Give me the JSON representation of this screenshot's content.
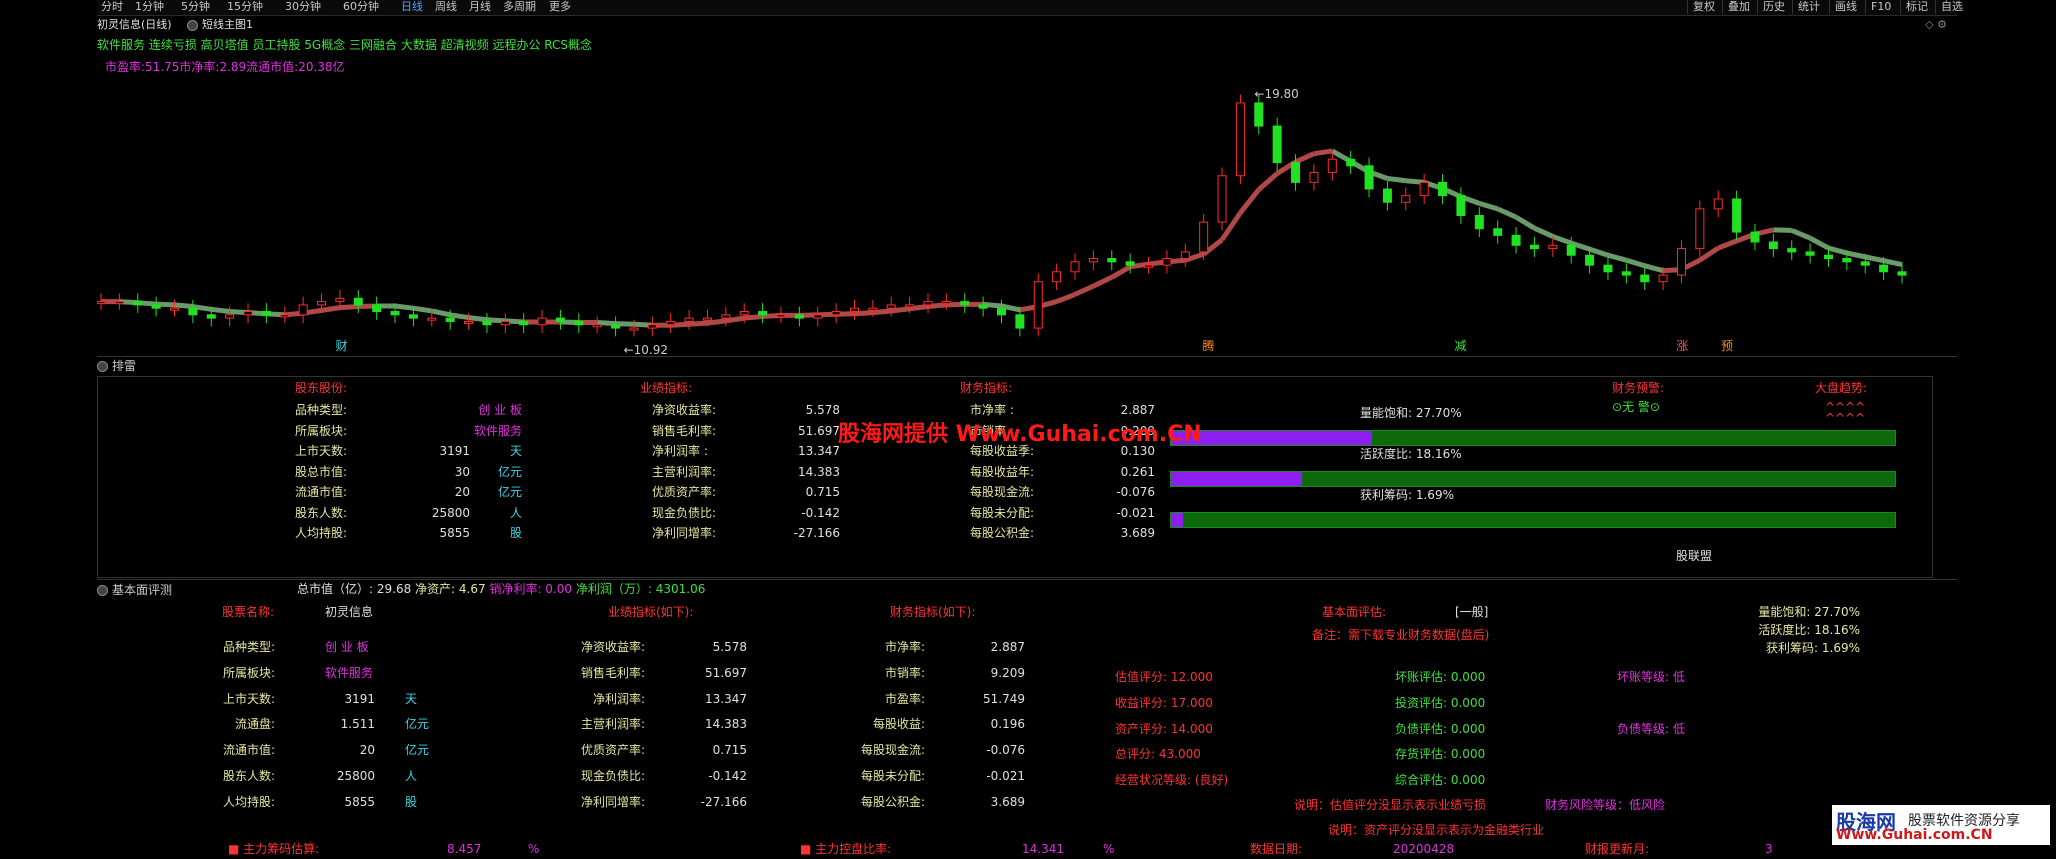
{
  "toolbar": {
    "periods": [
      "分时",
      "1分钟",
      "5分钟",
      "15分钟",
      "30分钟",
      "60分钟",
      "日线",
      "周线",
      "月线",
      "多周期",
      "更多"
    ],
    "active": "日线",
    "right": [
      "复权",
      "叠加",
      "历史",
      "统计",
      "画线",
      "F10",
      "标记",
      "自选"
    ]
  },
  "chart_header": {
    "title": "初灵信息(日线)",
    "indicator": "短线主图1",
    "concepts": "软件服务 连续亏损 高贝塔值 员工持股  5G概念 三网融合 大数据 超清视频 远程办公 RCS概念",
    "ratios": "市盈率:51.75市净率:2.89流通市值:20.38亿"
  },
  "chart_data": {
    "type": "candlestick",
    "high_label": "19.80",
    "low_label": "10.92",
    "markers": [
      "财",
      "腾",
      "减",
      "涨",
      "预"
    ],
    "closes": [
      12.0,
      12.0,
      11.9,
      11.8,
      11.8,
      11.6,
      11.5,
      11.6,
      11.7,
      11.6,
      11.6,
      11.9,
      12.0,
      12.1,
      11.9,
      11.7,
      11.6,
      11.5,
      11.5,
      11.4,
      11.4,
      11.3,
      11.4,
      11.3,
      11.5,
      11.4,
      11.3,
      11.3,
      11.2,
      11.2,
      11.3,
      11.4,
      11.5,
      11.5,
      11.6,
      11.7,
      11.6,
      11.6,
      11.5,
      11.6,
      11.7,
      11.8,
      11.8,
      11.9,
      11.9,
      12.0,
      12.0,
      11.9,
      11.8,
      11.6,
      11.2,
      12.6,
      12.9,
      13.2,
      13.3,
      13.2,
      13.1,
      13.1,
      13.3,
      13.5,
      14.4,
      15.8,
      18.0,
      17.3,
      16.2,
      15.6,
      15.9,
      16.3,
      16.1,
      15.4,
      15.0,
      15.2,
      15.6,
      15.2,
      14.6,
      14.2,
      14.0,
      13.7,
      13.6,
      13.7,
      13.4,
      13.1,
      12.9,
      12.8,
      12.6,
      12.8,
      13.6,
      14.8,
      15.1,
      14.1,
      13.8,
      13.6,
      13.5,
      13.4,
      13.3,
      13.2,
      13.1,
      12.9,
      12.8
    ],
    "ylabel": ""
  },
  "panel1": {
    "title": "排雷",
    "h_gudong": "股东股份:",
    "h_yeji": "业绩指标:",
    "h_caiwu": "财务指标:",
    "h_yujing": "财务预警:",
    "h_dapan": "大盘趋势:",
    "yujing_val": "无 警",
    "dapan_val": "^^^^",
    "col1": [
      {
        "label": "品种类型:",
        "value": "创 业 板",
        "unit": ""
      },
      {
        "label": "所属板块:",
        "value": "软件服务",
        "unit": ""
      },
      {
        "label": "上市天数:",
        "value": "3191",
        "unit": "天"
      },
      {
        "label": "股总市值:",
        "value": "30",
        "unit": "亿元"
      },
      {
        "label": "流通市值:",
        "value": "20",
        "unit": "亿元"
      },
      {
        "label": "股东人数:",
        "value": "25800",
        "unit": "人"
      },
      {
        "label": "人均持股:",
        "value": "5855",
        "unit": "股"
      }
    ],
    "col2": [
      {
        "label": "净资收益率:",
        "value": "5.578"
      },
      {
        "label": "销售毛利率:",
        "value": "51.697"
      },
      {
        "label": "净利润率  :",
        "value": "13.347"
      },
      {
        "label": "主营利润率:",
        "value": "14.383"
      },
      {
        "label": "优质资产率:",
        "value": "0.715"
      },
      {
        "label": "现金负债比:",
        "value": "-0.142"
      },
      {
        "label": "净利同增率:",
        "value": "-27.166"
      }
    ],
    "col3": [
      {
        "label": "市净率  :",
        "value": "2.887"
      },
      {
        "label": "市销率  :",
        "value": "9.209"
      },
      {
        "label": "每股收益季:",
        "value": "0.130"
      },
      {
        "label": "每股收益年:",
        "value": "0.261"
      },
      {
        "label": "每股现金流:",
        "value": "-0.076"
      },
      {
        "label": "每股未分配:",
        "value": "-0.021"
      },
      {
        "label": "每股公积金:",
        "value": "3.689"
      }
    ],
    "bars": [
      {
        "label": "量能饱和:  27.70%",
        "fraction": 0.277
      },
      {
        "label": "活跃度比:  18.16%",
        "fraction": 0.1816
      },
      {
        "label": "获利筹码:  1.69%",
        "fraction": 0.0169
      }
    ],
    "footer": "股联盟"
  },
  "panel2": {
    "title": "基本面评测",
    "summary_a": "总市值（亿）: 29.68",
    "summary_b": "净资产: 4.67",
    "summary_c": "销净利率: 0.00",
    "summary_d": "净利润（万）: 4301.06",
    "name_label": "股票名称:",
    "name_value": "初灵信息",
    "h_yeji": "业绩指标(如下):",
    "h_caiwu": "财务指标(如下):",
    "h_pingjia": "基本面评估:",
    "pingjia_val": "[一般]",
    "note": "备注：需下载专业财务数据(盘后)",
    "col1": [
      {
        "label": "品种类型:",
        "value": "创 业 板",
        "unit": ""
      },
      {
        "label": "所属板块:",
        "value": "软件服务",
        "unit": ""
      },
      {
        "label": "上市天数:",
        "value": "3191",
        "unit": "天"
      },
      {
        "label": "流通盘:",
        "value": "1.511",
        "unit": "亿元"
      },
      {
        "label": "流通市值:",
        "value": "20",
        "unit": "亿元"
      },
      {
        "label": "股东人数:",
        "value": "25800",
        "unit": "人"
      },
      {
        "label": "人均持股:",
        "value": "5855",
        "unit": "股"
      }
    ],
    "col2": [
      {
        "label": "净资收益率:",
        "value": "5.578"
      },
      {
        "label": "销售毛利率:",
        "value": "51.697"
      },
      {
        "label": "净利润率:",
        "value": "13.347"
      },
      {
        "label": "主营利润率:",
        "value": "14.383"
      },
      {
        "label": "优质资产率:",
        "value": "0.715"
      },
      {
        "label": "现金负债比:",
        "value": "-0.142"
      },
      {
        "label": "净利同增率:",
        "value": "-27.166"
      }
    ],
    "col3": [
      {
        "label": "市净率:",
        "value": "2.887"
      },
      {
        "label": "市销率:",
        "value": "9.209"
      },
      {
        "label": "市盈率:",
        "value": "51.749"
      },
      {
        "label": "每股收益:",
        "value": "0.196"
      },
      {
        "label": "每股现金流:",
        "value": "-0.076"
      },
      {
        "label": "每股未分配:",
        "value": "-0.021"
      },
      {
        "label": "每股公积金:",
        "value": "3.689"
      }
    ],
    "scores": [
      "估值评分: 12.000",
      "收益评分: 17.000",
      "资产评分: 14.000",
      "总评分: 43.000",
      "经营状况等级: (良好)"
    ],
    "evals": [
      "坏账评估: 0.000",
      "投资评估: 0.000",
      "负债评估: 0.000",
      "存货评估: 0.000",
      "综合评估: 0.000"
    ],
    "levels": [
      "坏账等级: 低",
      "负债等级: 低"
    ],
    "right_stats": [
      "量能饱和:  27.70%",
      "活跃度比:  18.16%",
      "获利筹码:  1.69%"
    ],
    "explain1": "说明：估值评分没显示表示业绩亏损",
    "risk": "财务风险等级：低风险",
    "explain2": "说明：资产评分没显示表示为金融类行业",
    "bottom": [
      {
        "label": "■ 主力筹码估算:",
        "value": "8.457",
        "unit": "%"
      },
      {
        "label": "■ 主力控盘比率:",
        "value": "14.341",
        "unit": "%"
      },
      {
        "label": "数据日期:",
        "value": "20200428",
        "unit": ""
      },
      {
        "label": "财报更新月:",
        "value": "3",
        "unit": ""
      }
    ]
  },
  "watermark": "股海网提供 Www.Guhai.com.CN",
  "logo": {
    "line1": "股海网",
    "line2": "股票软件资源分享",
    "line3": "Www.Guhai.com.CN"
  }
}
